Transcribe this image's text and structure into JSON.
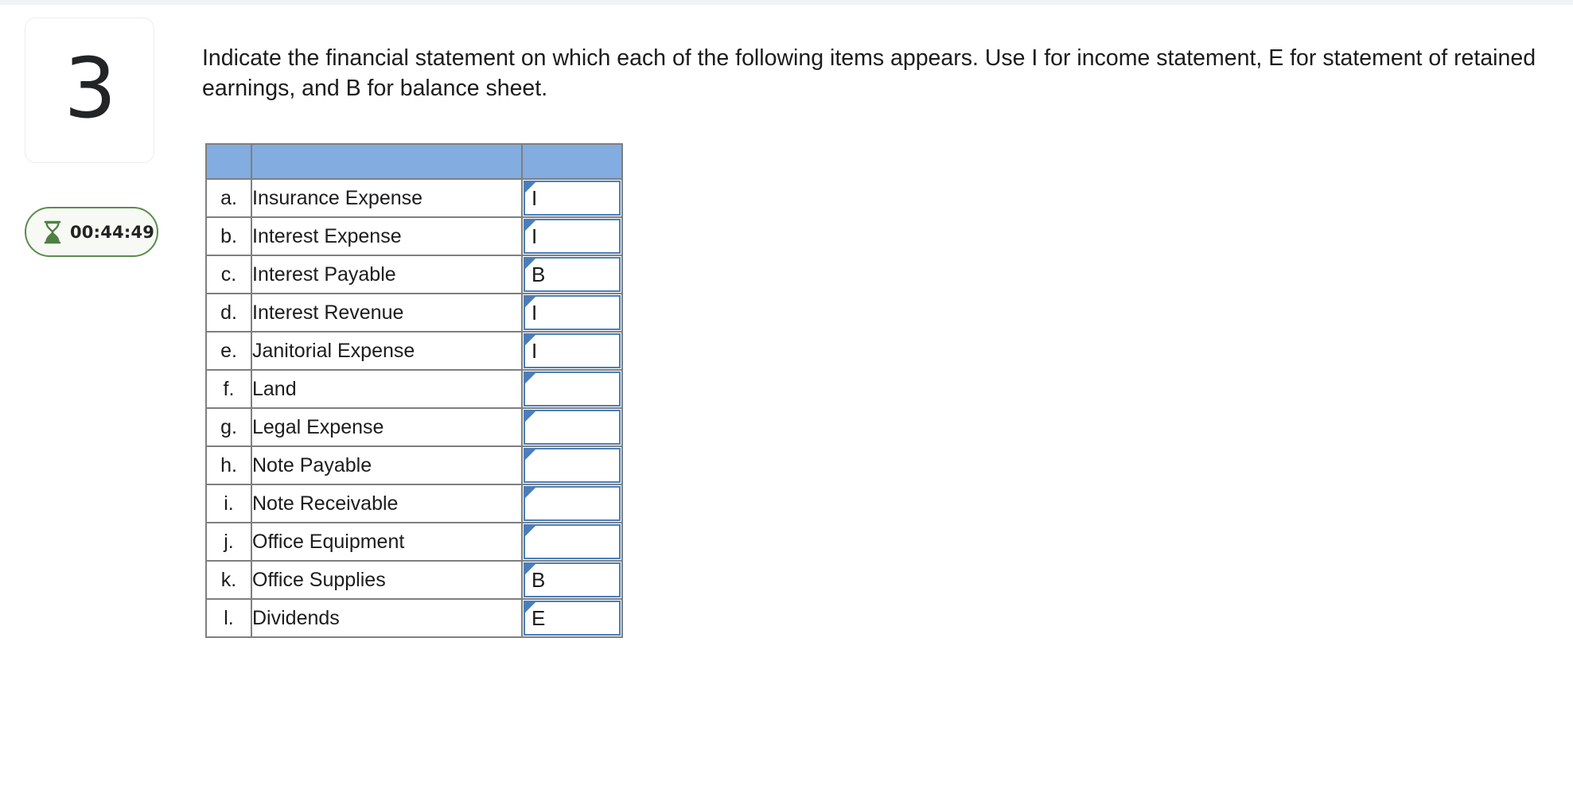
{
  "question": {
    "number": "3",
    "prompt": "Indicate the financial statement on which each of the following items appears. Use I for income statement, E for statement of retained earnings, and B for balance sheet."
  },
  "timer": {
    "value": "00:44:49",
    "icon": "hourglass-icon",
    "border_color": "#5a8c4e",
    "background_color": "#f6f9f4"
  },
  "table": {
    "header": {
      "letter": "",
      "item": "",
      "answer": "",
      "fill_color": "#83ace0"
    },
    "answer_input": {
      "border_color": "#4a7ebb",
      "marker_color": "#4a7ebb",
      "placeholder": ""
    },
    "rows": [
      {
        "letter": "a.",
        "item": "Insurance Expense",
        "answer": "I"
      },
      {
        "letter": "b.",
        "item": "Interest Expense",
        "answer": "I"
      },
      {
        "letter": "c.",
        "item": "Interest Payable",
        "answer": "B"
      },
      {
        "letter": "d.",
        "item": "Interest Revenue",
        "answer": "I"
      },
      {
        "letter": "e.",
        "item": "Janitorial Expense",
        "answer": "I"
      },
      {
        "letter": "f.",
        "item": "Land",
        "answer": ""
      },
      {
        "letter": "g.",
        "item": "Legal Expense",
        "answer": ""
      },
      {
        "letter": "h.",
        "item": "Note Payable",
        "answer": ""
      },
      {
        "letter": "i.",
        "item": "Note Receivable",
        "answer": ""
      },
      {
        "letter": "j.",
        "item": "Office Equipment",
        "answer": ""
      },
      {
        "letter": "k.",
        "item": "Office Supplies",
        "answer": "B"
      },
      {
        "letter": "l.",
        "item": "Dividends",
        "answer": "E"
      }
    ]
  }
}
